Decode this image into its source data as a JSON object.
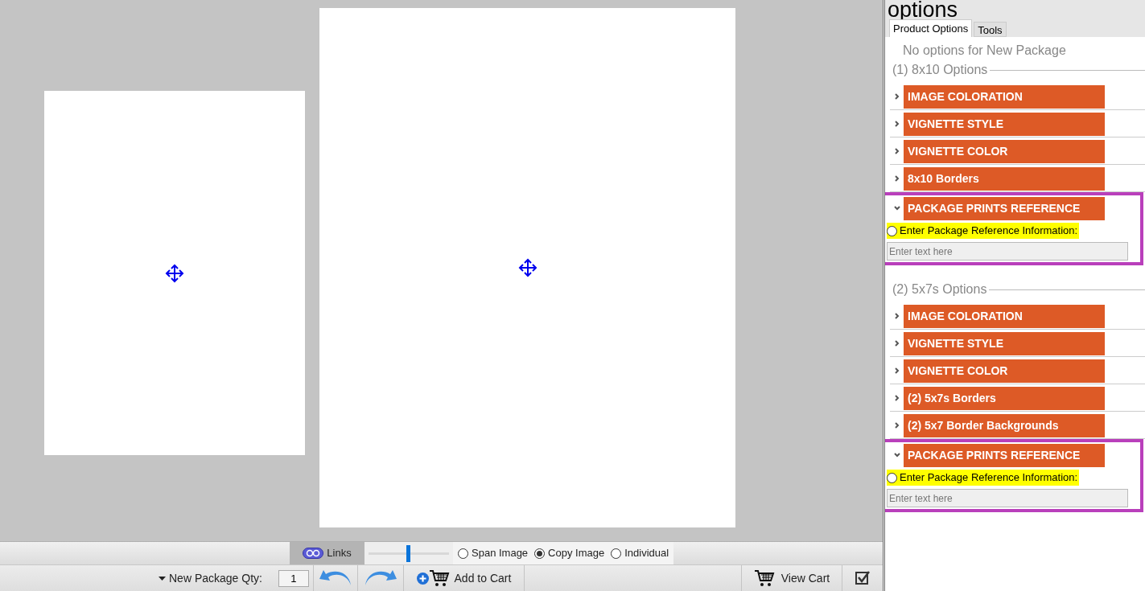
{
  "panel": {
    "title": "options",
    "tabs": [
      {
        "label": "Product Options",
        "selected": true
      },
      {
        "label": "Tools",
        "selected": false
      }
    ],
    "notice": "No options for New Package",
    "sections": [
      {
        "title": "(1) 8x10 Options",
        "options": [
          {
            "label": "IMAGE COLORATION",
            "expanded": false
          },
          {
            "label": "VIGNETTE STYLE",
            "expanded": false
          },
          {
            "label": "VIGNETTE COLOR",
            "expanded": false
          },
          {
            "label": "8x10 Borders",
            "expanded": false
          },
          {
            "label": "PACKAGE PRINTS REFERENCE",
            "expanded": true,
            "highlighted": true,
            "field": {
              "radio_label": "Enter Package Reference Information:",
              "checked": false,
              "placeholder": "Enter text here"
            }
          }
        ]
      },
      {
        "title": "(2) 5x7s Options",
        "options": [
          {
            "label": "IMAGE COLORATION",
            "expanded": false
          },
          {
            "label": "VIGNETTE STYLE",
            "expanded": false
          },
          {
            "label": "VIGNETTE COLOR",
            "expanded": false
          },
          {
            "label": "(2) 5x7s Borders",
            "expanded": false
          },
          {
            "label": "(2) 5x7 Border Backgrounds",
            "expanded": false
          },
          {
            "label": "PACKAGE PRINTS REFERENCE",
            "expanded": true,
            "highlighted": true,
            "field": {
              "radio_label": "Enter Package Reference Information:",
              "checked": false,
              "placeholder": "Enter text here"
            }
          }
        ]
      }
    ]
  },
  "toolbar": {
    "links": "Links",
    "zoom": {
      "level": 0.49
    },
    "modes": [
      {
        "label": "Span Image",
        "selected": false
      },
      {
        "label": "Copy Image",
        "selected": true
      },
      {
        "label": "Individual",
        "selected": false
      }
    ],
    "qty_label": "New Package Qty:",
    "qty": "1",
    "add_to_cart": "Add to Cart",
    "view_cart": "View Cart"
  }
}
